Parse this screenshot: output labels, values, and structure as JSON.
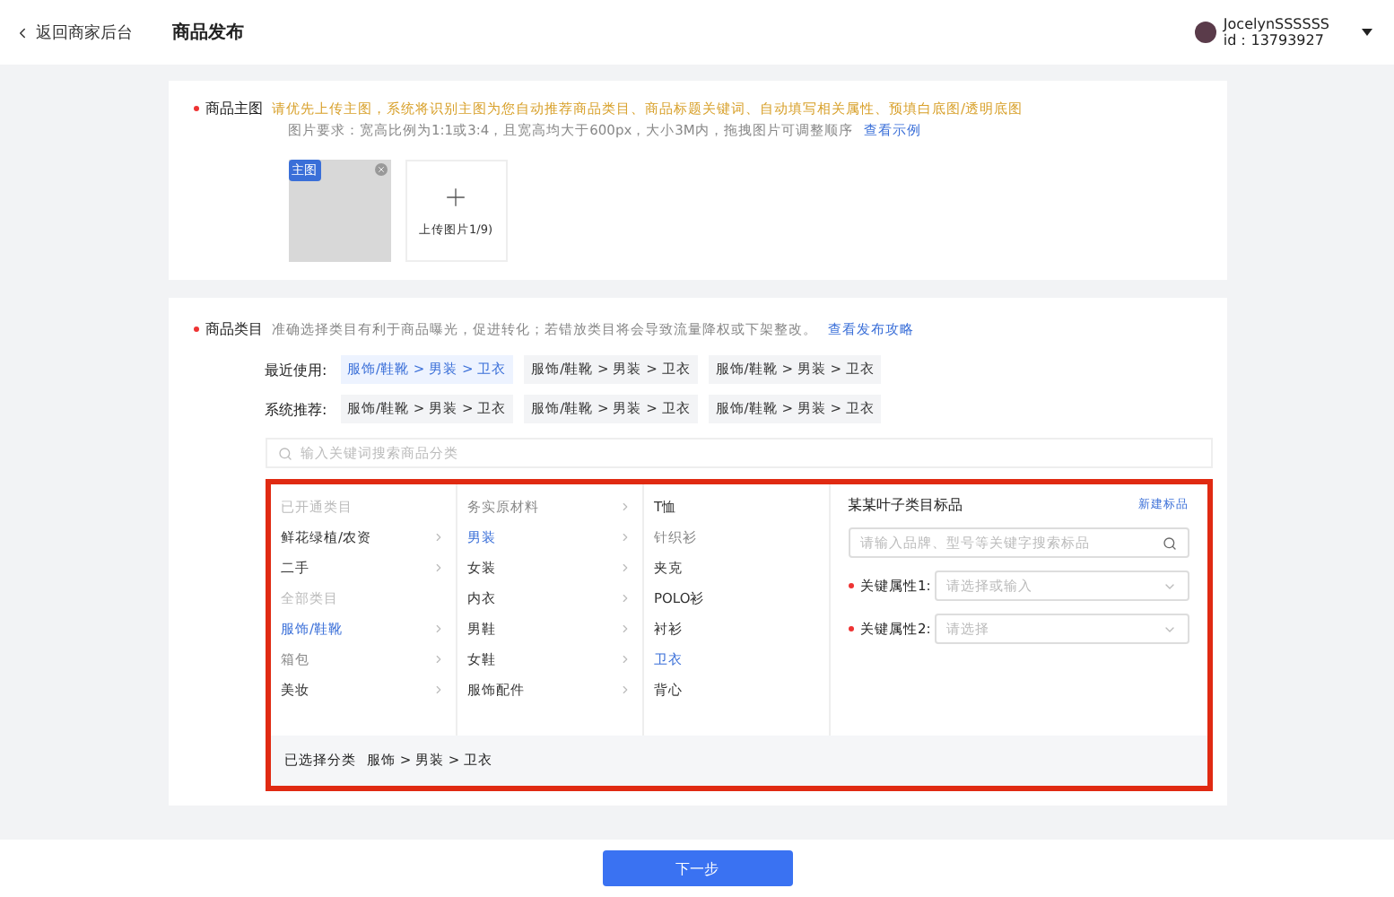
{
  "header": {
    "back": "返回商家后台",
    "title": "商品发布",
    "user": {
      "name": "JocelynSSSSSS",
      "id": "id：13793927"
    }
  },
  "main_image": {
    "label": "商品主图",
    "required": true,
    "tip": "请优先上传主图，系统将识别主图为您自动推荐商品类目、商品标题关键词、自动填写相关属性、预填白底图/透明底图",
    "requirement": "图片要求：宽高比例为1:1或3:4，且宽高均大于600px，大小3M内，拖拽图片可调整顺序",
    "example_link": "查看示例",
    "badge": "主图",
    "upload_label": "上传图片1/9)"
  },
  "category": {
    "label": "商品类目",
    "required": true,
    "tip": "准确选择类目有利于商品曝光，促进转化；若错放类目将会导致流量降权或下架整改。",
    "guide_link": "查看发布攻略",
    "recent": {
      "label": "最近使用:",
      "chips": [
        {
          "text": "服饰/鞋靴 > 男装 > 卫衣",
          "selected": true
        },
        {
          "text": "服饰/鞋靴 > 男装 > 卫衣",
          "selected": false
        },
        {
          "text": "服饰/鞋靴 > 男装 > 卫衣",
          "selected": false
        }
      ]
    },
    "recommended": {
      "label": "系统推荐:",
      "chips": [
        {
          "text": "服饰/鞋靴 > 男装 > 卫衣",
          "selected": false
        },
        {
          "text": "服饰/鞋靴 > 男装 > 卫衣",
          "selected": false
        },
        {
          "text": "服饰/鞋靴 > 男装 > 卫衣",
          "selected": false
        }
      ]
    },
    "search_placeholder": "输入关键词搜索商品分类",
    "columns": [
      [
        {
          "kind": "group",
          "text": "已开通类目"
        },
        {
          "kind": "item",
          "text": "鲜花绿植/农资",
          "selected": false,
          "disabled": false
        },
        {
          "kind": "item",
          "text": "二手",
          "selected": false,
          "disabled": false
        },
        {
          "kind": "group",
          "text": "全部类目"
        },
        {
          "kind": "item",
          "text": "服饰/鞋靴",
          "selected": true,
          "disabled": false
        },
        {
          "kind": "item",
          "text": "箱包",
          "selected": false,
          "disabled": true
        },
        {
          "kind": "item",
          "text": "美妆",
          "selected": false,
          "disabled": false
        }
      ],
      [
        {
          "kind": "item",
          "text": "务实原材料",
          "selected": false,
          "disabled": true
        },
        {
          "kind": "item",
          "text": "男装",
          "selected": true,
          "disabled": false
        },
        {
          "kind": "item",
          "text": "女装",
          "selected": false,
          "disabled": false
        },
        {
          "kind": "item",
          "text": "内衣",
          "selected": false,
          "disabled": false
        },
        {
          "kind": "item",
          "text": "男鞋",
          "selected": false,
          "disabled": false
        },
        {
          "kind": "item",
          "text": "女鞋",
          "selected": false,
          "disabled": false
        },
        {
          "kind": "item",
          "text": "服饰配件",
          "selected": false,
          "disabled": false
        }
      ],
      [
        {
          "kind": "leaf",
          "text": "T恤",
          "selected": false,
          "disabled": false
        },
        {
          "kind": "leaf",
          "text": "针织衫",
          "selected": false,
          "disabled": true
        },
        {
          "kind": "leaf",
          "text": "夹克",
          "selected": false,
          "disabled": false
        },
        {
          "kind": "leaf",
          "text": "POLO衫",
          "selected": false,
          "disabled": false
        },
        {
          "kind": "leaf",
          "text": "衬衫",
          "selected": false,
          "disabled": false
        },
        {
          "kind": "leaf",
          "text": "卫衣",
          "selected": true,
          "disabled": false
        },
        {
          "kind": "leaf",
          "text": "背心",
          "selected": false,
          "disabled": false
        }
      ]
    ],
    "standard": {
      "title": "某某叶子类目标品",
      "new_link": "新建标品",
      "search_placeholder": "请输入品牌、型号等关键字搜索标品",
      "attributes": [
        {
          "label": "关键属性1:",
          "placeholder": "请选择或输入",
          "required": true
        },
        {
          "label": "关键属性2:",
          "placeholder": "请选择",
          "required": true
        }
      ]
    },
    "selected_label": "已选择分类",
    "selected_path": "服饰 > 男装 > 卫衣"
  },
  "footer": {
    "next_button": "下一步"
  }
}
